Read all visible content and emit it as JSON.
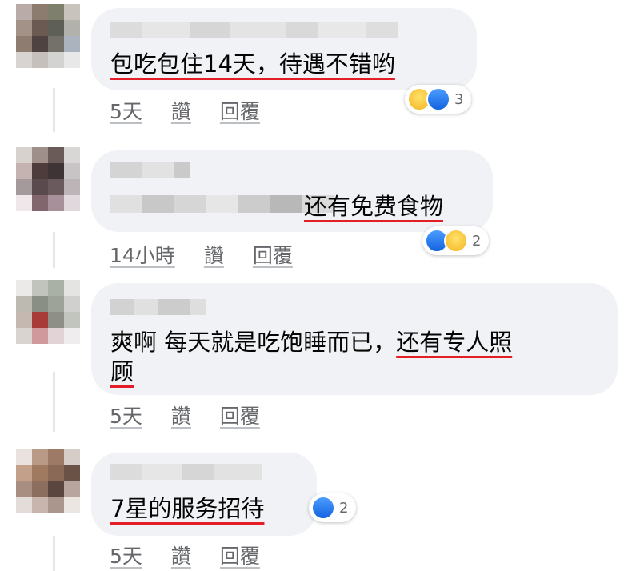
{
  "colors": {
    "bubble_bg": "#f0f2f5",
    "text": "#050505",
    "meta": "#65676b",
    "highlight_underline": "#e41e26",
    "like_blue": "#1877f2"
  },
  "comments": [
    {
      "text_plain": "",
      "text_highlight": "包吃包住14天，待遇不错哟",
      "text_line2": "",
      "time": "5天",
      "like_label": "讚",
      "reply_label": "回覆",
      "reactions": [
        "haha",
        "like"
      ],
      "reaction_count": "3"
    },
    {
      "text_plain": "",
      "text_highlight": "还有免费食物",
      "text_line2": "",
      "time": "14小時",
      "like_label": "讚",
      "reply_label": "回覆",
      "reactions": [
        "like",
        "haha"
      ],
      "reaction_count": "2"
    },
    {
      "text_plain": "爽啊 每天就是吃饱睡而已，",
      "text_highlight": "还有专人照",
      "text_line2": "顾",
      "time": "5天",
      "like_label": "讚",
      "reply_label": "回覆",
      "reactions": [],
      "reaction_count": ""
    },
    {
      "text_plain": "",
      "text_highlight": "7星的服务招待",
      "text_line2": "",
      "time": "5天",
      "like_label": "讚",
      "reply_label": "回覆",
      "reactions": [
        "like"
      ],
      "reaction_count": "2"
    }
  ]
}
